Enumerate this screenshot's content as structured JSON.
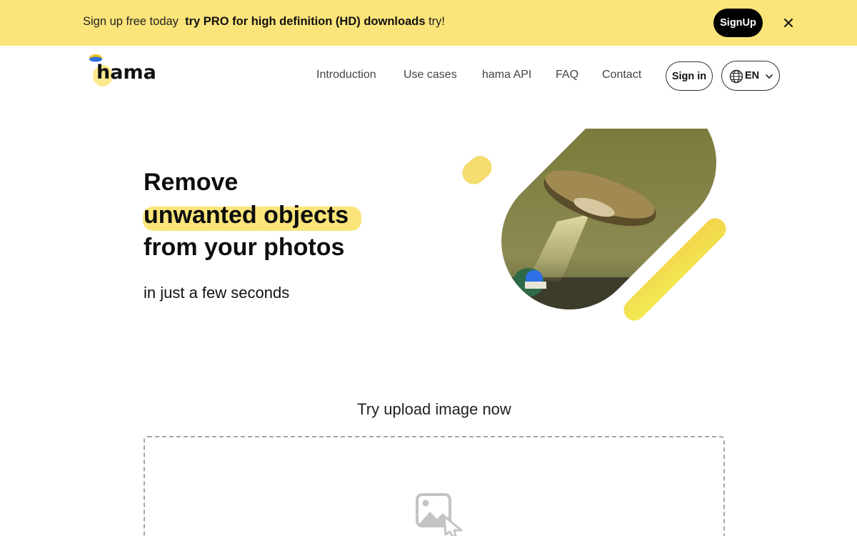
{
  "promo": {
    "text_prefix": "Sign up free today",
    "text_bold": "try PRO for high definition (HD) downloads",
    "text_suffix": "try!",
    "signup_label": "SignUp",
    "close_icon": "close-icon",
    "background": "#fbe57a"
  },
  "header": {
    "logo_text": "hama",
    "nav": [
      "Introduction",
      "Use cases",
      "hama API",
      "FAQ",
      "Contact"
    ],
    "signin_label": "Sign in",
    "language": "EN",
    "globe_icon": "globe-icon",
    "chevron_icon": "chevron-down-icon"
  },
  "hero": {
    "line1": "Remove",
    "line2": "unwanted objects",
    "line3": "from your photos",
    "subtitle": "in just a few seconds",
    "accent": "#fbe57a"
  },
  "upload": {
    "title": "Try upload image now",
    "icon": "image-upload-icon"
  }
}
